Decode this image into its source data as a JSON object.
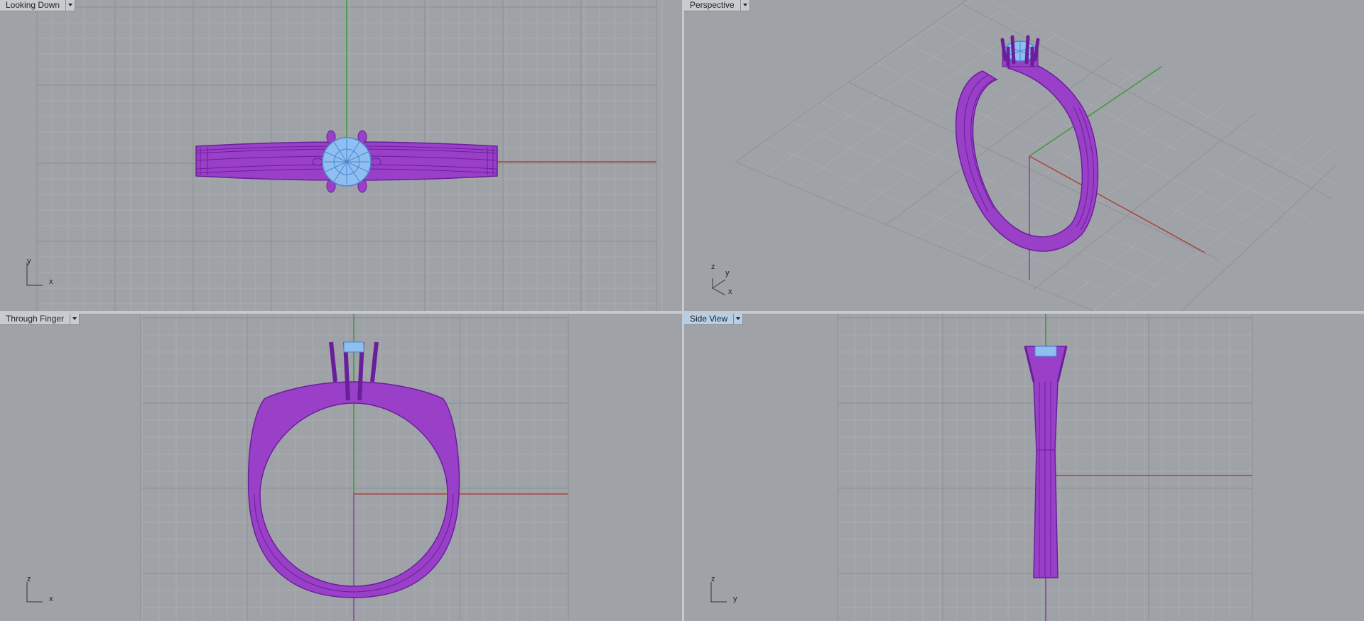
{
  "viewports": [
    {
      "key": "top",
      "title": "Looking Down",
      "active": false,
      "axes": [
        "y",
        "x"
      ]
    },
    {
      "key": "persp",
      "title": "Perspective",
      "active": false,
      "axes": [
        "z",
        "y",
        "x"
      ]
    },
    {
      "key": "front",
      "title": "Through Finger",
      "active": false,
      "axes": [
        "z",
        "x"
      ]
    },
    {
      "key": "right",
      "title": "Side View",
      "active": true,
      "axes": [
        "z",
        "y"
      ]
    }
  ],
  "colors": {
    "background": "#9fa3a8",
    "grid_minor": "#a9adb1",
    "grid_major": "#8f9398",
    "x_axis": "#b0403a",
    "y_axis": "#3c9a3c",
    "z_axis": "#8a3fa8",
    "ring": "#9a3fc8",
    "ring_stroke": "#6a1f9a",
    "stone": "#8fbff0",
    "stone_stroke": "#4a86d0"
  },
  "icons": {
    "dropdown": "chevron-down-icon",
    "axis": "axis-triad-icon"
  }
}
